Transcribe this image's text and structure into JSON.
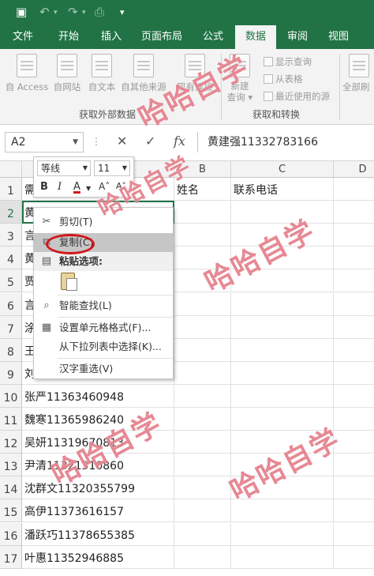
{
  "quick_access": {
    "customize": "▾"
  },
  "tabs": [
    "文件",
    "开始",
    "插入",
    "页面布局",
    "公式",
    "数据",
    "审阅",
    "视图"
  ],
  "active_tab": "数据",
  "ribbon": {
    "get_external": [
      "自 Access",
      "自网站",
      "自文本",
      "自其他来源",
      "现有连接"
    ],
    "get_external_label": "获取外部数据",
    "new_query": "新建\n查询",
    "new_query_label": "新建",
    "new_query_sub": "查询 ▾",
    "transform_items": [
      "显示查询",
      "从表格",
      "最近使用的源"
    ],
    "transform_label": "获取和转换",
    "refresh_all": "全部刷"
  },
  "formula_bar": {
    "name_box": "A2",
    "cancel": "✕",
    "enter": "✓",
    "fx": "fx",
    "content": "黄建强11332783166"
  },
  "columns": [
    "A",
    "B",
    "C",
    "D"
  ],
  "rows": [
    {
      "n": "1",
      "a": "需要复制的内容",
      "b": "姓名",
      "c": "联系电话"
    },
    {
      "n": "2",
      "a": "黄建强11332783166",
      "b": "",
      "c": ""
    },
    {
      "n": "3",
      "a": "言",
      "b": "",
      "c": ""
    },
    {
      "n": "4",
      "a": "黄",
      "b": "",
      "c": ""
    },
    {
      "n": "5",
      "a": "贾",
      "b": "",
      "c": ""
    },
    {
      "n": "6",
      "a": "言",
      "b": "",
      "c": ""
    },
    {
      "n": "7",
      "a": "涂",
      "b": "",
      "c": ""
    },
    {
      "n": "8",
      "a": "王",
      "b": "",
      "c": ""
    },
    {
      "n": "9",
      "a": "刘",
      "b": "",
      "c": ""
    },
    {
      "n": "10",
      "a": "张严11363460948",
      "b": "",
      "c": ""
    },
    {
      "n": "11",
      "a": "魏寒11365986240",
      "b": "",
      "c": ""
    },
    {
      "n": "12",
      "a": "吴妍11319670813",
      "b": "",
      "c": ""
    },
    {
      "n": "13",
      "a": "尹清11321310860",
      "b": "",
      "c": ""
    },
    {
      "n": "14",
      "a": "沈群文11320355799",
      "b": "",
      "c": ""
    },
    {
      "n": "15",
      "a": "高伊11373616157",
      "b": "",
      "c": ""
    },
    {
      "n": "16",
      "a": "潘跃巧11378655385",
      "b": "",
      "c": ""
    },
    {
      "n": "17",
      "a": "叶惠11352946885",
      "b": "",
      "c": ""
    }
  ],
  "mini_toolbar": {
    "font": "等线",
    "size": "11",
    "bold": "B",
    "italic": "I",
    "color": "A",
    "grow": "A˄",
    "shrink": "A˅"
  },
  "context_menu": {
    "cut": "剪切(T)",
    "copy": "复制(C)",
    "paste_options": "粘贴选项:",
    "smart_lookup": "智能查找(L)",
    "format_cells": "设置单元格格式(F)...",
    "pick_list": "从下拉列表中选择(K)...",
    "reconvert": "汉字重选(V)"
  },
  "watermark": "哈哈自学"
}
